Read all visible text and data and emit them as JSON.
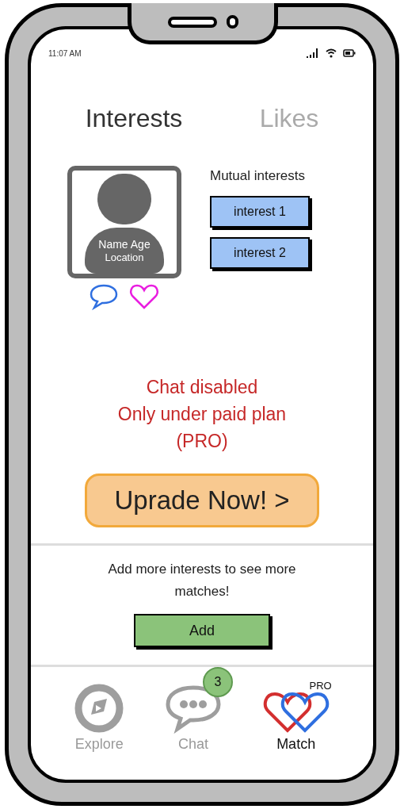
{
  "status_bar": {
    "time": "11:07 AM"
  },
  "tabs": [
    {
      "label": "Interests",
      "selected": true
    },
    {
      "label": "Likes",
      "selected": false
    }
  ],
  "profile": {
    "name_age": "Name Age",
    "location": "Location"
  },
  "mutual_interests": {
    "title": "Mutual interests",
    "items": [
      "interest 1",
      "interest 2"
    ]
  },
  "notice": {
    "lines": [
      "Chat disabled",
      "Only under paid plan",
      "(PRO)"
    ]
  },
  "upgrade_button": "Uprade Now! >",
  "add_section": {
    "text": "Add more interests to see more matches!",
    "button": "Add"
  },
  "nav": [
    {
      "kind": "explore",
      "label": "Explore",
      "selected": false
    },
    {
      "kind": "chat",
      "label": "Chat",
      "selected": false,
      "badge": "3"
    },
    {
      "kind": "match",
      "label": "Match",
      "selected": true,
      "tag": "PRO"
    }
  ]
}
